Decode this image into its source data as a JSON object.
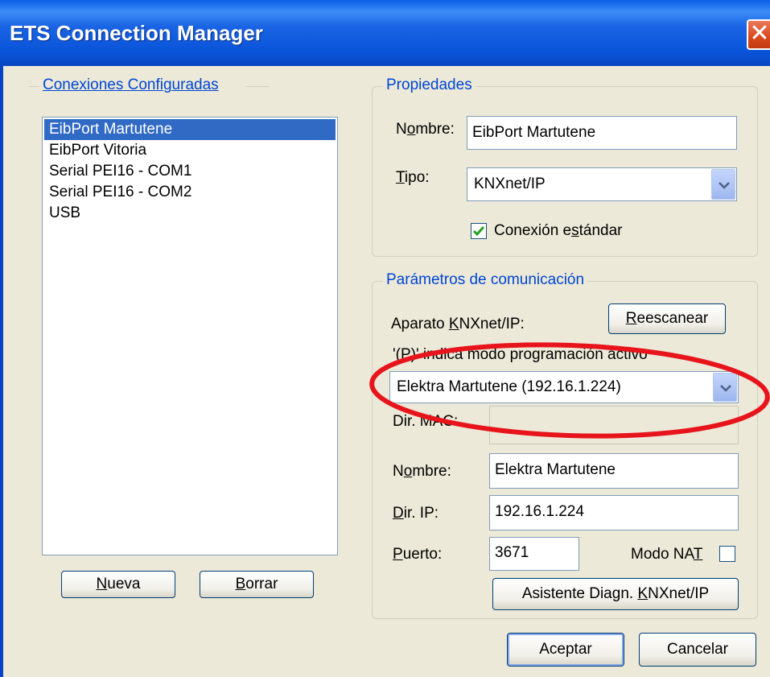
{
  "window": {
    "title": "ETS Connection Manager",
    "close_glyph": "✕"
  },
  "connections": {
    "legend": "Conexiones Configuradas",
    "items": [
      {
        "label": "EibPort Martutene",
        "selected": true
      },
      {
        "label": "EibPort Vitoria",
        "selected": false
      },
      {
        "label": "Serial PEI16 - COM1",
        "selected": false
      },
      {
        "label": "Serial PEI16 - COM2",
        "selected": false
      },
      {
        "label": "USB",
        "selected": false
      }
    ],
    "new_button": {
      "pre": "",
      "key": "N",
      "post": "ueva"
    },
    "delete_button": {
      "pre": "",
      "key": "B",
      "post": "orrar"
    }
  },
  "properties": {
    "legend": "Propiedades",
    "name_label": {
      "pre": "N",
      "key": "o",
      "post": "mbre:"
    },
    "name_value": "EibPort Martutene",
    "type_label": {
      "pre": "",
      "key": "T",
      "post": "ipo:"
    },
    "type_value": "KNXnet/IP",
    "standard_connection": {
      "pre": "Conexión e",
      "key": "s",
      "post": "tándar",
      "checked": true
    }
  },
  "communication": {
    "legend": "Parámetros de comunicación",
    "device_label": {
      "pre": "Aparato ",
      "key": "K",
      "post": "NXnet/IP:"
    },
    "rescan_button": {
      "pre": "",
      "key": "R",
      "post": "eescanear"
    },
    "programming_hint": "'(P)' indica modo programación activo",
    "device_selected": "Elektra Martutene (192.16.1.224)",
    "mac_label": "Dir. MAC:",
    "mac_value": "",
    "name_label": {
      "pre": "N",
      "key": "o",
      "post": "mbre:"
    },
    "name_value": "Elektra Martutene",
    "ip_label": {
      "pre": "",
      "key": "D",
      "post": "ir. IP:"
    },
    "ip_value": "192.16.1.224",
    "port_label": {
      "pre": "",
      "key": "P",
      "post": "uerto:"
    },
    "port_value": "3671",
    "nat_label": {
      "pre": "Modo NA",
      "key": "T",
      "post": ""
    },
    "nat_checked": false,
    "diag_button": {
      "pre": "Asistente Diagn. ",
      "key": "K",
      "post": "NXnet/IP"
    }
  },
  "footer": {
    "ok_label": "Aceptar",
    "cancel_label": "Cancelar"
  },
  "colors": {
    "titlebar": "#0853d9",
    "selection": "#316ac5",
    "annotation_circle": "#e8141c",
    "legend_text": "#0046d5"
  }
}
